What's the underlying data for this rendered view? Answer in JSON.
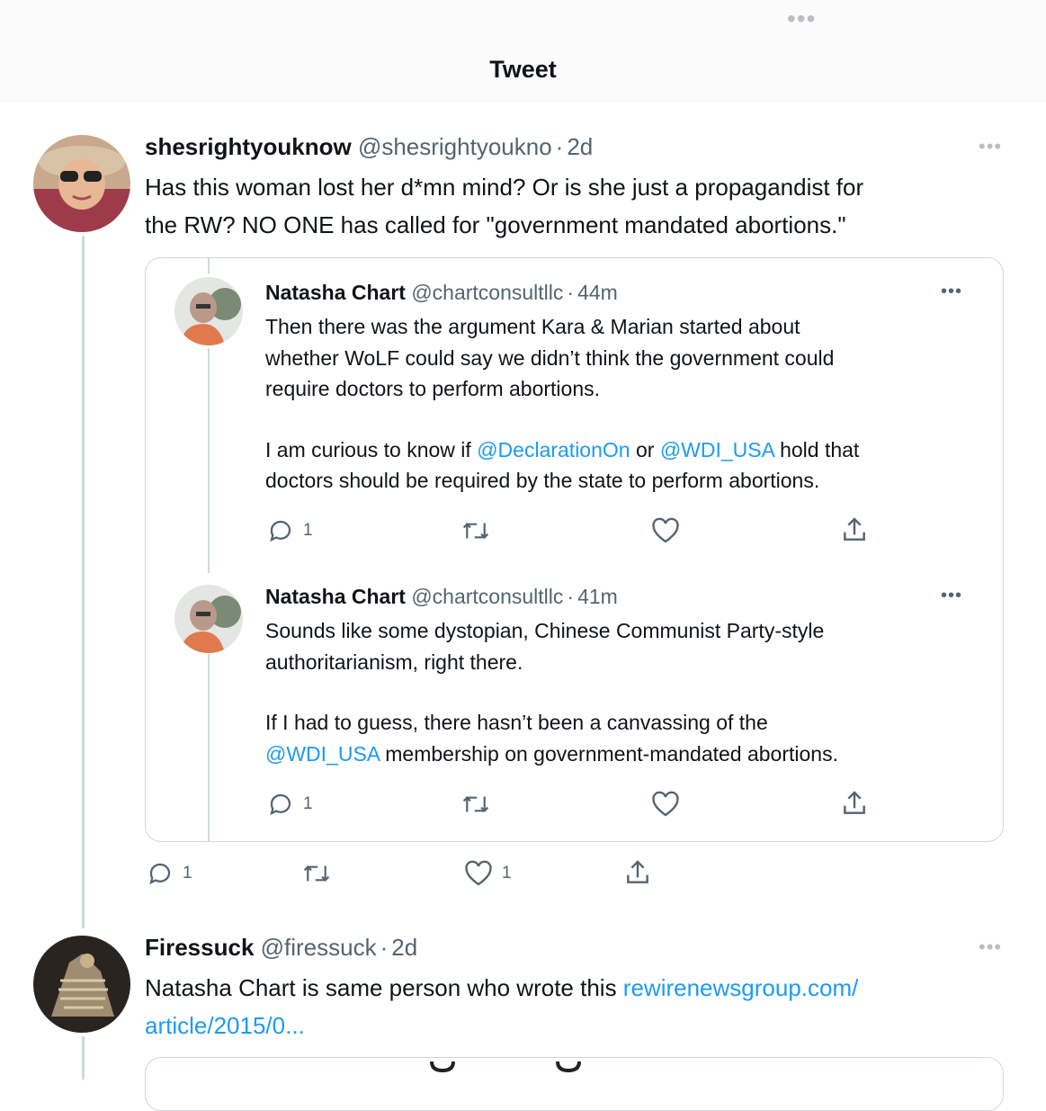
{
  "header": {
    "title": "Tweet",
    "more_icon": "more-horizontal-icon"
  },
  "main_tweet": {
    "display_name": "shesrightyouknow",
    "handle": "@shesrightyoukno",
    "sep": "·",
    "time": "2d",
    "text_lines": [
      "Has this woman lost her d*mn mind? Or is she just a propagandist for",
      "the RW? NO ONE has called for \"government mandated abortions.\""
    ],
    "actions": {
      "reply_count": "1",
      "retweet_count": "",
      "like_count": "1"
    }
  },
  "quoted": [
    {
      "display_name": "Natasha Chart",
      "handle": "@chartconsultllc",
      "sep": "·",
      "time": "44m",
      "para1": [
        "Then there was the argument Kara & Marian started about",
        "whether WoLF could say we didn’t think the government could",
        "require doctors to perform abortions."
      ],
      "para2_line1_a": "I am curious to know if ",
      "para2_mention1": "@DeclarationOn",
      "para2_line1_b": " or ",
      "para2_mention2": "@WDI_USA",
      "para2_line1_c": " hold that",
      "para2_line2": "doctors should be required by the state to perform abortions.",
      "reply_count": "1"
    },
    {
      "display_name": "Natasha Chart",
      "handle": "@chartconsultllc",
      "sep": "·",
      "time": "41m",
      "para1": [
        "Sounds like some dystopian, Chinese Communist Party-style",
        "authoritarianism, right there."
      ],
      "para2_line1": "If I had to guess, there hasn’t been a canvassing of the",
      "para2_mention": "@WDI_USA",
      "para2_line2_rest": " membership on government-mandated abortions.",
      "reply_count": "1"
    }
  ],
  "reply_tweet": {
    "display_name": "Firessuck",
    "handle": "@firessuck",
    "sep": "·",
    "time": "2d",
    "text_a": "Natasha Chart is same person who wrote this ",
    "link_a": "rewirenewsgroup.com/",
    "link_b": "article/2015/0..."
  },
  "colors": {
    "accent": "#1d9bf0",
    "secondary_text": "#536471",
    "border": "#cfd9de"
  }
}
